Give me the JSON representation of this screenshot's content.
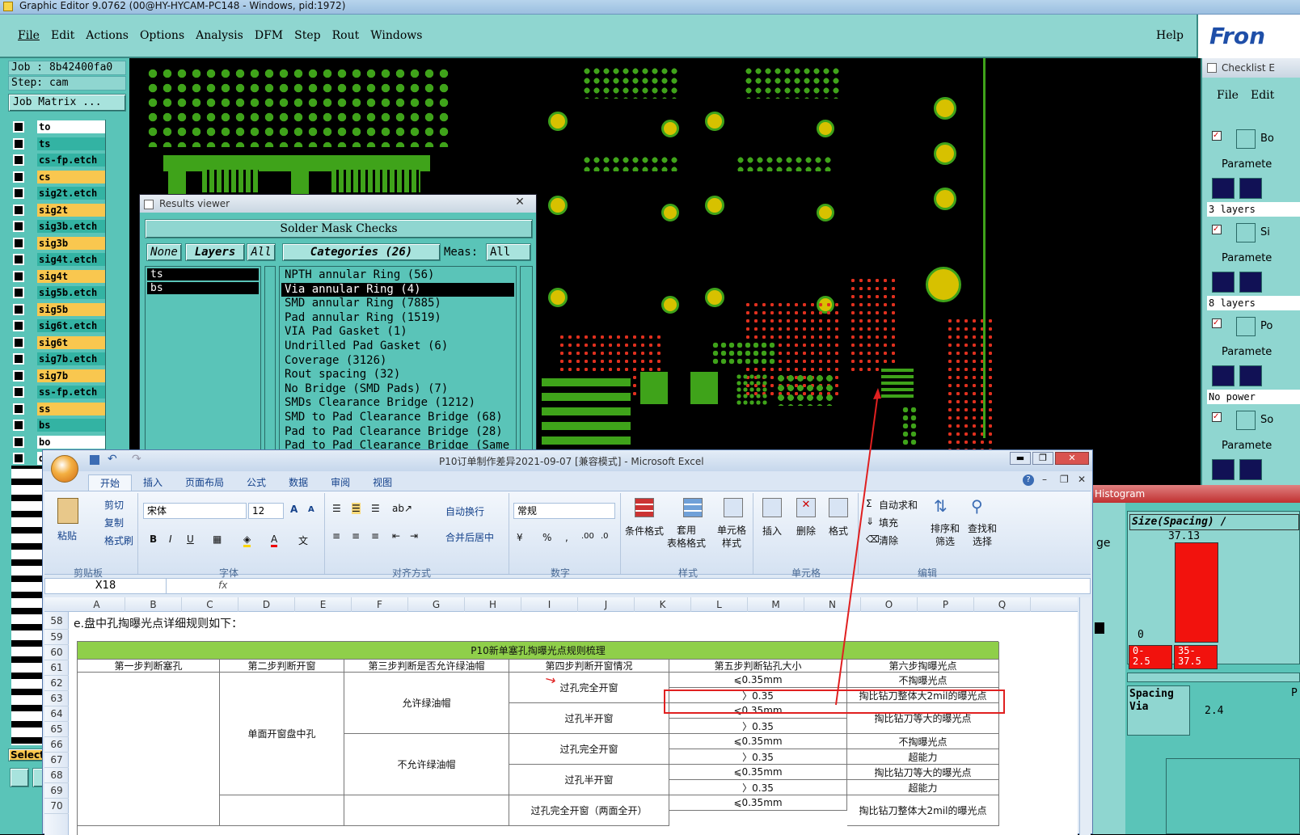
{
  "app": {
    "title": "Graphic Editor 9.0762 (00@HY-HYCAM-PC148 - Windows, pid:1972)",
    "help": "Help",
    "brand": "Fron"
  },
  "menu": [
    "File",
    "Edit",
    "Actions",
    "Options",
    "Analysis",
    "DFM",
    "Step",
    "Rout",
    "Windows"
  ],
  "job": {
    "job_label": "Job : 8b42400fa0",
    "step_label": "Step: cam",
    "matrix_button": "Job Matrix ..."
  },
  "layers": [
    {
      "name": "to",
      "style": "w"
    },
    {
      "name": "ts",
      "style": "t"
    },
    {
      "name": "cs-fp.etch",
      "style": "t"
    },
    {
      "name": "cs",
      "style": "y"
    },
    {
      "name": "sig2t.etch",
      "style": "t"
    },
    {
      "name": "sig2t",
      "style": "y"
    },
    {
      "name": "sig3b.etch",
      "style": "t"
    },
    {
      "name": "sig3b",
      "style": "y"
    },
    {
      "name": "sig4t.etch",
      "style": "t"
    },
    {
      "name": "sig4t",
      "style": "y"
    },
    {
      "name": "sig5b.etch",
      "style": "t"
    },
    {
      "name": "sig5b",
      "style": "y"
    },
    {
      "name": "sig6t.etch",
      "style": "t"
    },
    {
      "name": "sig6t",
      "style": "y"
    },
    {
      "name": "sig7b.etch",
      "style": "t"
    },
    {
      "name": "sig7b",
      "style": "y"
    },
    {
      "name": "ss-fp.etch",
      "style": "t"
    },
    {
      "name": "ss",
      "style": "y"
    },
    {
      "name": "bs",
      "style": "t"
    },
    {
      "name": "bo",
      "style": "w"
    },
    {
      "name": "drl",
      "style": "w"
    }
  ],
  "select_label": "Select",
  "results": {
    "title": "Results viewer",
    "panel_title": "Solder Mask Checks",
    "none": "None",
    "layers": "Layers",
    "all": "All",
    "categories": "Categories (26)",
    "meas_label": "Meas:",
    "meas_value": "All",
    "layer_items": [
      "ts",
      "bs"
    ],
    "category_items": [
      "NPTH annular Ring (56)",
      "Via annular Ring (4)",
      "SMD annular Ring (7885)",
      "Pad annular Ring (1519)",
      "VIA Pad Gasket (1)",
      "Undrilled Pad Gasket (6)",
      "Coverage (3126)",
      "Rout spacing (32)",
      "No Bridge (SMD Pads) (7)",
      "SMDs Clearance Bridge (1212)",
      "SMD to Pad Clearance Bridge (68)",
      "Pad to Pad Clearance Bridge (28)",
      "Pad to Pad Clearance Bridge (Same"
    ]
  },
  "checklist": {
    "title": "Checklist E",
    "file": "File",
    "edit": "Edit",
    "items": [
      {
        "label": "Bo",
        "param": "Paramete",
        "note": "3 layers"
      },
      {
        "label": "Si",
        "param": "Paramete",
        "note": "8 layers"
      },
      {
        "label": "Po",
        "param": "Paramete",
        "note": "No power"
      },
      {
        "label": "So",
        "param": "Paramete",
        "note": ""
      }
    ]
  },
  "histogram": {
    "title": "Histogram",
    "left_text": "ge",
    "size_label": "Size(Spacing) /",
    "bar_value": "37.13",
    "zero": "0",
    "range1": "0-\n2.5",
    "range2": "35-\n37.5",
    "spacing": "Spacing\nVia",
    "value": "2.4",
    "p_label": "P"
  },
  "excel": {
    "title": "P10订单制作差异2021-09-07 [兼容模式] - Microsoft Excel",
    "tabs": [
      "开始",
      "插入",
      "页面布局",
      "公式",
      "数据",
      "审阅",
      "视图"
    ],
    "clipboard": {
      "paste": "粘贴",
      "cut": "剪切",
      "copy": "复制",
      "format": "格式刷",
      "group": "剪贴板"
    },
    "font": {
      "name": "宋体",
      "size": "12",
      "group": "字体"
    },
    "align": {
      "wrap": "自动换行",
      "merge": "合并后居中",
      "group": "对齐方式"
    },
    "number": {
      "format": "常规",
      "group": "数字"
    },
    "styles": {
      "cond": "条件格式",
      "table": "套用\n表格格式",
      "cell": "单元格\n样式",
      "group": "样式"
    },
    "cells": {
      "insert": "插入",
      "delete": "删除",
      "format": "格式",
      "group": "单元格"
    },
    "edit": {
      "autosum": "自动求和",
      "fill": "填充",
      "clear": "清除",
      "sort": "排序和\n筛选",
      "find": "查找和\n选择",
      "group": "编辑"
    },
    "namebox": "X18",
    "fx": "fx",
    "columns": [
      "A",
      "B",
      "C",
      "D",
      "E",
      "F",
      "G",
      "H",
      "I",
      "J",
      "K",
      "L",
      "M",
      "N",
      "O",
      "P",
      "Q"
    ],
    "rows": [
      "58",
      "59",
      "60",
      "61",
      "62",
      "63",
      "64",
      "65",
      "66",
      "67",
      "68",
      "69",
      "70"
    ],
    "heading": "e.盘中孔掏曝光点详细规则如下：",
    "table_title": "P10新单塞孔掏曝光点规则梳理",
    "headers": [
      "第一步判断塞孔",
      "第二步判断开窗",
      "第三步判断是否允许绿油帽",
      "第四步判断开窗情况",
      "第五步判断钻孔大小",
      "第六步掏曝光点"
    ],
    "c2": "单面开窗盘中孔",
    "c3a": "允许绿油帽",
    "c3b": "不允许绿油帽",
    "c4": [
      "过孔完全开窗",
      "过孔半开窗",
      "过孔完全开窗",
      "过孔半开窗",
      "过孔完全开窗（两面全开）"
    ],
    "c5": [
      "⩽0.35mm",
      "〉0.35",
      "⩽0.35mm",
      "〉0.35",
      "⩽0.35mm",
      "〉0.35",
      "⩽0.35mm",
      "〉0.35",
      "⩽0.35mm"
    ],
    "c6": [
      "不掏曝光点",
      "掏比钻刀整体大2mil的曝光点",
      "掏比钻刀等大的曝光点",
      "不掏曝光点",
      "超能力",
      "掏比钻刀等大的曝光点",
      "超能力",
      "掏比钻刀整体大2mil的曝光点"
    ]
  }
}
